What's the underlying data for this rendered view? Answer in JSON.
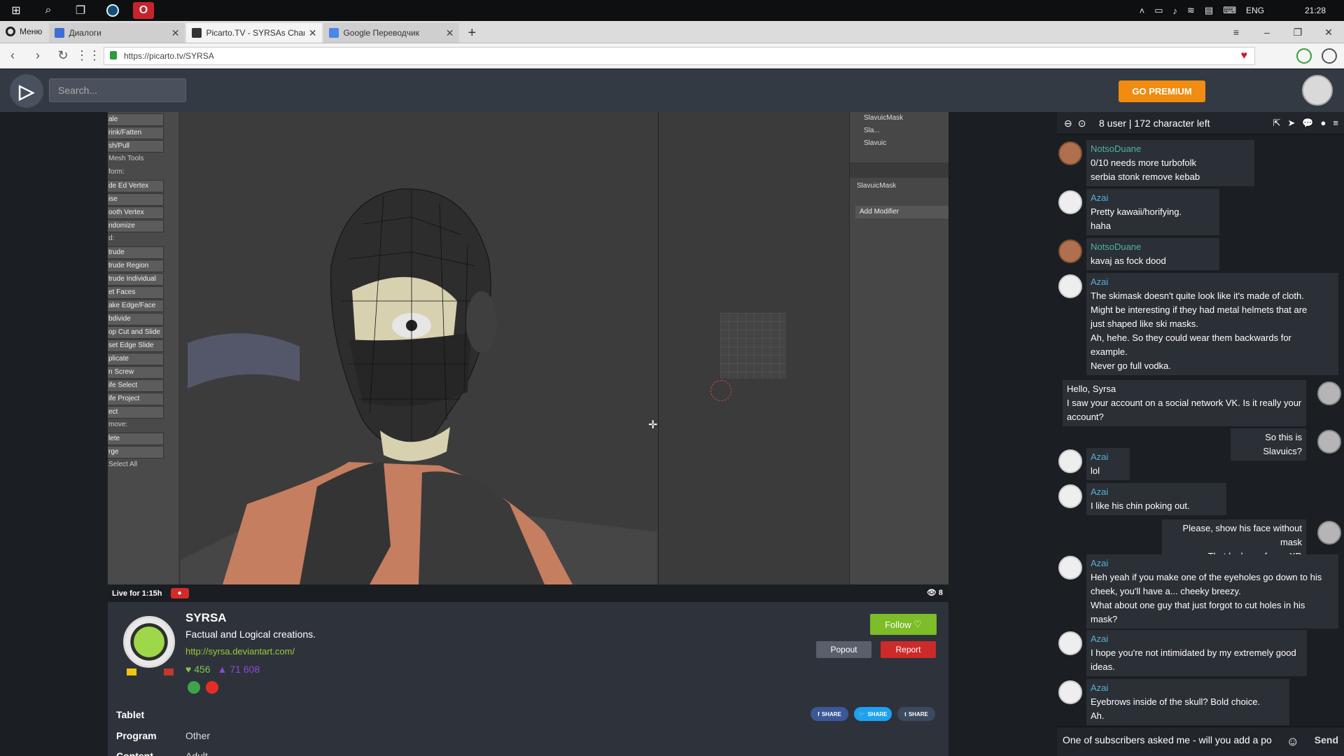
{
  "taskbar": {
    "lang": "ENG",
    "time": "21:28"
  },
  "browser": {
    "menu_label": "Меню",
    "tabs": [
      {
        "label": "Диалоги",
        "active": false
      },
      {
        "label": "Picarto.TV - SYRSAs Chan",
        "active": true
      },
      {
        "label": "Google Переводчик",
        "active": false
      }
    ],
    "url": "https://picarto.tv/SYRSA"
  },
  "header": {
    "logo_text": "TV",
    "search_placeholder": "Search...",
    "premium_label": "GO PREMIUM"
  },
  "blender": {
    "left_tools": [
      "ale",
      "rink/Fatten",
      "sh/Pull",
      "Mesh Tools",
      "form:",
      "de Ed  Vertex",
      "ise",
      "ooth Vertex",
      "ndomize",
      "d:",
      "trude",
      "trude Region",
      "trude Individual",
      "et Faces",
      "ake Edge/Face",
      "bdivide",
      "op Cut and Slide",
      "set Edge Slide",
      "plicate",
      "n      Screw",
      "ife    Select",
      "ife Project",
      "ect",
      "move:",
      "lete",
      "rge",
      "Select All"
    ],
    "tree": [
      "SlavuicMask",
      "Sla...",
      "Slavuic"
    ],
    "props_object": "SlavuicMask",
    "add_modifier": "Add Modifier"
  },
  "stream": {
    "live_text": "Live for 1:15h",
    "viewers": "8"
  },
  "channel": {
    "name": "SYRSA",
    "description": "Factual and Logical creations.",
    "link": "http://syrsa.deviantart.com/",
    "likes": "456",
    "views": "71 608",
    "follow_label": "Follow",
    "popout_label": "Popout",
    "report_label": "Report",
    "meta": [
      {
        "key": "Tablet",
        "value": ""
      },
      {
        "key": "Program",
        "value": "Other"
      },
      {
        "key": "Content",
        "value": "Adult"
      }
    ],
    "share": [
      "SHARE",
      "SHARE",
      "SHARE"
    ]
  },
  "chat": {
    "header": "8 user | 172 character left",
    "messages": [
      {
        "user": "NotsoDuane",
        "lines": [
          "0/10 needs more turbofolk",
          "serbia stonk remove kebab"
        ]
      },
      {
        "user": "Azai",
        "lines": [
          "Pretty kawaii/horifying.",
          "haha"
        ]
      },
      {
        "user": "NotsoDuane",
        "lines": [
          "kavaj as fock dood"
        ]
      },
      {
        "user": "Azai",
        "lines": [
          "The skimask doesn't quite look like it's made of cloth.",
          "Might be interesting if they had metal helmets that are",
          "just shaped like ski masks.",
          "Ah, hehe. So they could wear them backwards for",
          "example.",
          "Never go full vodka."
        ]
      },
      {
        "user": "",
        "lines": [
          "Hello, Syrsa",
          "I saw your account on a social network VK. Is it really your",
          "account?"
        ]
      },
      {
        "user": "",
        "lines": [
          "So this is Slavuics?"
        ]
      },
      {
        "user": "Azai",
        "lines": [
          "lol"
        ]
      },
      {
        "user": "Azai",
        "lines": [
          "I like his chin poking out."
        ]
      },
      {
        "user": "",
        "lines": [
          "Please, show his face without mask",
          "That looks so funny XD"
        ]
      },
      {
        "user": "Azai",
        "lines": [
          "Heh yeah if you make one of the eyeholes go down to his",
          "cheek, you'll have a... cheeky breezy.",
          "What about one guy that just forgot to cut holes in his",
          "mask?"
        ]
      },
      {
        "user": "Azai",
        "lines": [
          "I hope you're not intimidated by my extremely good",
          "ideas."
        ]
      },
      {
        "user": "Azai",
        "lines": [
          "Eyebrows inside of the skull? Bold choice.",
          "Ah."
        ]
      }
    ],
    "input_value": "One of subscribers asked me - will you add a po",
    "send_label": "Send"
  }
}
